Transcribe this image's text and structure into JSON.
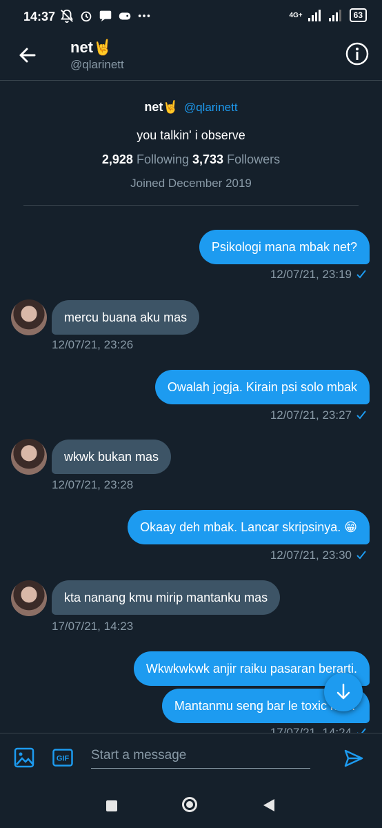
{
  "status": {
    "time": "14:37",
    "network": "4G+",
    "battery": "63"
  },
  "header": {
    "name": "net🤘",
    "handle": "@qlarinett"
  },
  "profile": {
    "name": "net🤘",
    "handle": "@qlarinett",
    "bio": "you talkin' i observe",
    "following_count": "2,928",
    "following_label": "Following",
    "followers_count": "3,733",
    "followers_label": "Followers",
    "joined": "Joined December 2019"
  },
  "messages": [
    {
      "side": "sent",
      "text": "Psikologi mana mbak net?",
      "time": "12/07/21, 23:19"
    },
    {
      "side": "recv",
      "text": "mercu buana aku mas",
      "time": "12/07/21, 23:26"
    },
    {
      "side": "sent",
      "text": "Owalah jogja. Kirain psi solo mbak",
      "time": "12/07/21, 23:27"
    },
    {
      "side": "recv",
      "text": "wkwk bukan mas",
      "time": "12/07/21, 23:28"
    },
    {
      "side": "sent",
      "text": "Okaay deh mbak. Lancar skripsinya. 😁",
      "time": "12/07/21, 23:30"
    },
    {
      "side": "recv",
      "text": "kta nanang kmu mirip mantanku mas",
      "time": "17/07/21, 14:23"
    },
    {
      "side": "sent",
      "text": "Wkwkwkwk anjir raiku pasaran berarti.",
      "time": ""
    },
    {
      "side": "sent",
      "text": "Mantanmu seng bar le toxic kae?",
      "time": "17/07/21, 14:24"
    }
  ],
  "composer": {
    "placeholder": "Start a message",
    "gif_label": "GIF"
  },
  "colors": {
    "background": "#15202b",
    "accent": "#1d9bf0",
    "received_bubble": "#3d5466",
    "muted_text": "#8899a6"
  }
}
